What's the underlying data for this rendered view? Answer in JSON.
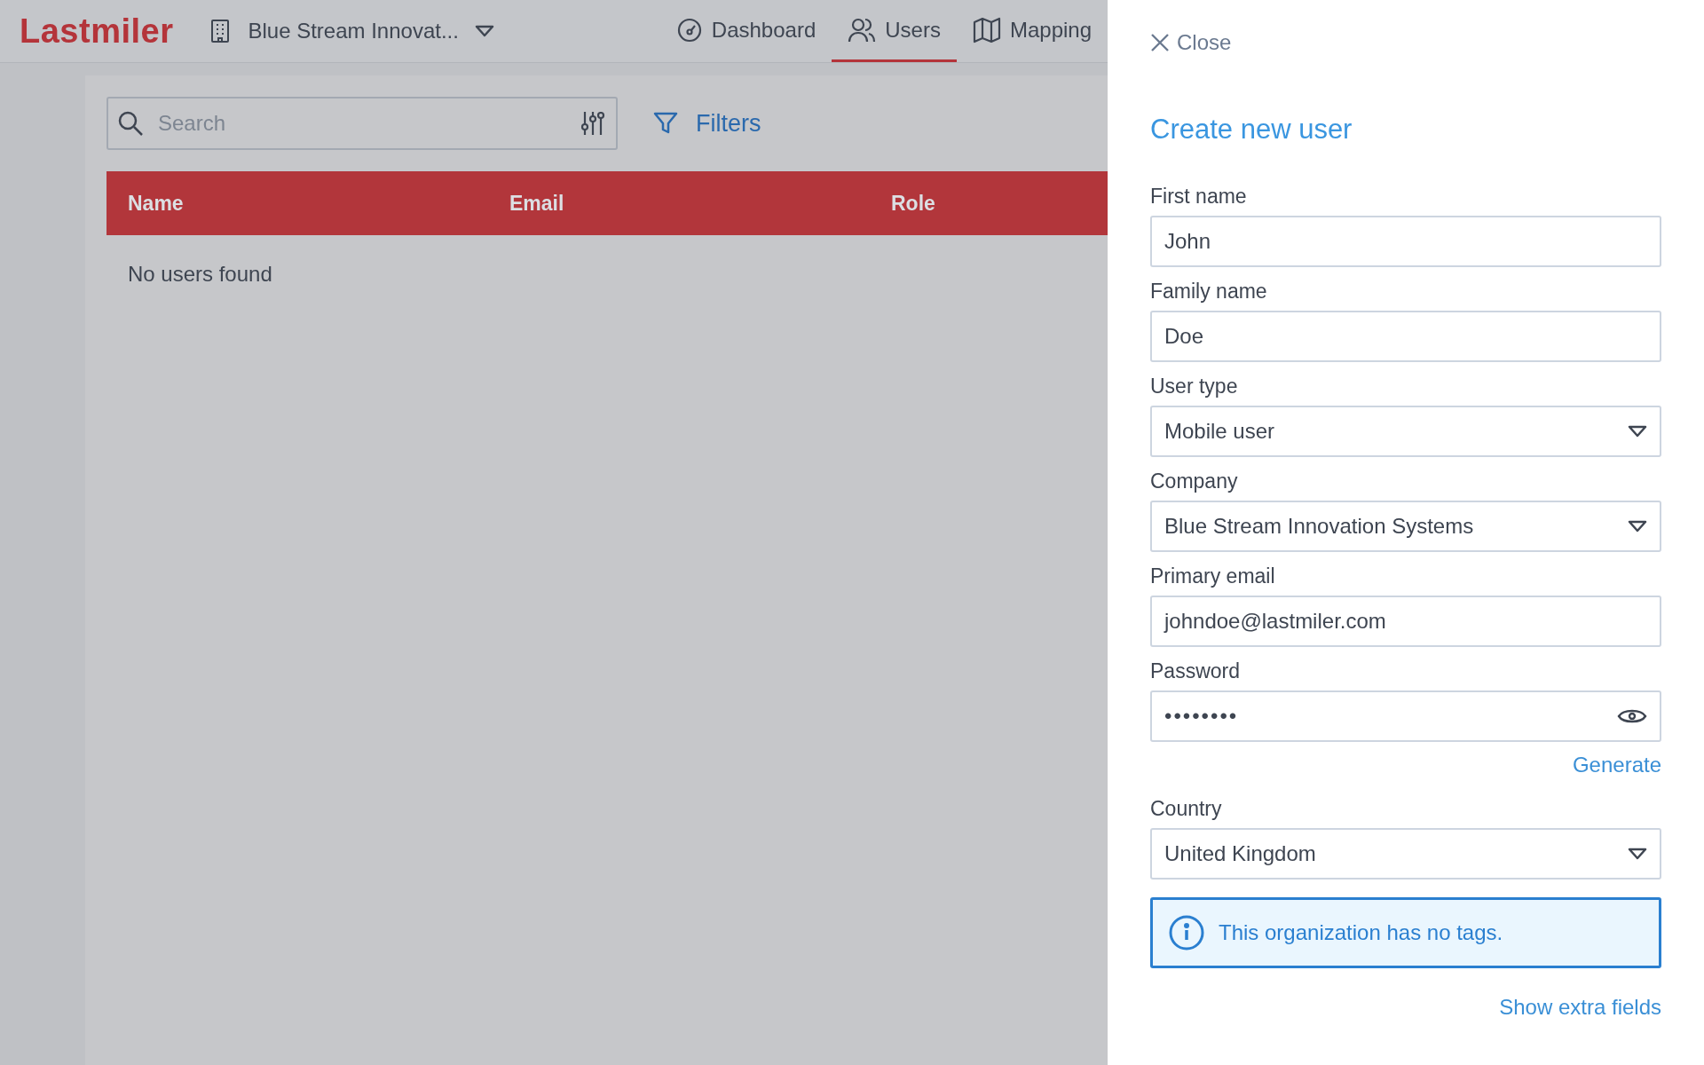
{
  "header": {
    "logo": "Lastmiler",
    "organization": "Blue Stream Innovat...",
    "nav": [
      {
        "label": "Dashboard",
        "kind": "gauge",
        "selected": false
      },
      {
        "label": "Users",
        "kind": "users",
        "selected": true
      },
      {
        "label": "Mapping",
        "kind": "map",
        "selected": false
      }
    ]
  },
  "toolbar": {
    "search": {
      "placeholder": "Search"
    },
    "filters": "Filters"
  },
  "table": {
    "columns": [
      "Name",
      "Email",
      "Role"
    ],
    "empty_message": "No users found"
  },
  "drawer": {
    "close": "Close",
    "title": "Create new user",
    "fields": [
      {
        "kind": "text",
        "label": "First name",
        "value": "John"
      },
      {
        "kind": "text",
        "label": "Family name",
        "value": "Doe"
      },
      {
        "kind": "select",
        "label": "User type",
        "value": "Mobile user"
      },
      {
        "kind": "select",
        "label": "Company",
        "value": "Blue Stream Innovation Systems"
      },
      {
        "kind": "text",
        "label": "Primary email",
        "value": "johndoe@lastmiler.com"
      },
      {
        "kind": "password",
        "label": "Password",
        "value": "••••••••",
        "action": "Generate"
      },
      {
        "kind": "select",
        "label": "Country",
        "value": "United Kingdom"
      }
    ],
    "notice": "This organization has no tags.",
    "extra_link": "Show extra fields"
  }
}
